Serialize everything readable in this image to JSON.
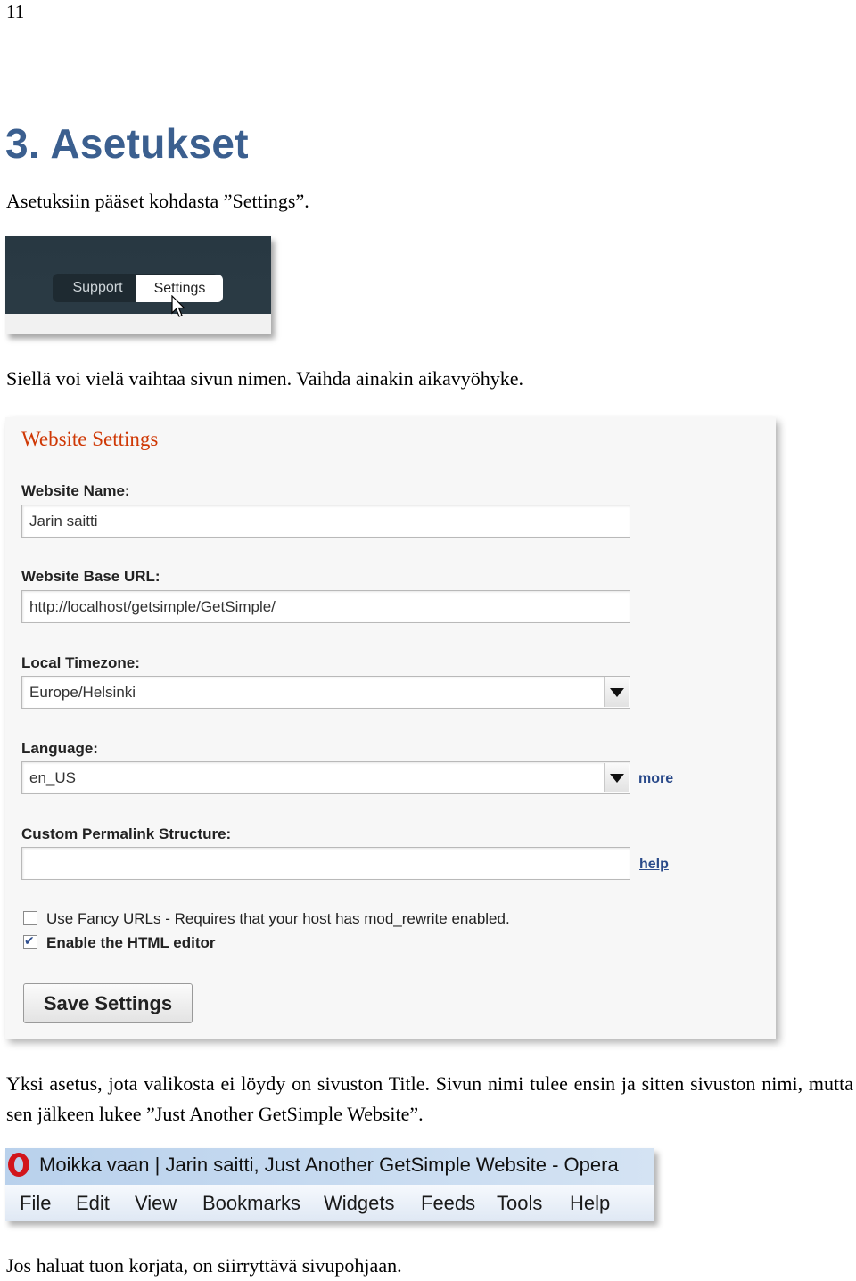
{
  "page": {
    "page_number": "11",
    "heading": "3. Asetukset",
    "para1": "Asetuksiin pääset kohdasta ”Settings”.",
    "para2": "Siellä voi vielä vaihtaa sivun nimen. Vaihda ainakin aikavyöhyke.",
    "para3": "Yksi asetus, jota valikosta ei löydy on sivuston Title. Sivun nimi tulee ensin ja sitten sivuston nimi, mutta sen jälkeen lukee ”Just Another GetSimple Website”.",
    "para4": "Jos haluat tuon korjata, on siirryttävä sivupohjaan."
  },
  "nav_screenshot": {
    "tabs": [
      "Support",
      "Settings"
    ]
  },
  "settings_screenshot": {
    "title": "Website Settings",
    "website_name_label": "Website Name:",
    "website_name_value": "Jarin saitti",
    "base_url_label": "Website Base URL:",
    "base_url_value": "http://localhost/getsimple/GetSimple/",
    "timezone_label": "Local Timezone:",
    "timezone_value": "Europe/Helsinki",
    "language_label": "Language:",
    "language_value": "en_US",
    "language_link": "more",
    "permalink_label": "Custom Permalink Structure:",
    "permalink_value": "",
    "permalink_link": "help",
    "fancy_urls_label": "Use Fancy URLs - Requires that your host has mod_rewrite enabled.",
    "fancy_urls_checked": false,
    "html_editor_label": "Enable the HTML editor",
    "html_editor_checked": true,
    "save_button": "Save Settings"
  },
  "browser_screenshot": {
    "window_title": "Moikka vaan | Jarin saitti, Just Another GetSimple Website - Opera",
    "menu": [
      "File",
      "Edit",
      "View",
      "Bookmarks",
      "Widgets",
      "Feeds",
      "Tools",
      "Help"
    ]
  }
}
